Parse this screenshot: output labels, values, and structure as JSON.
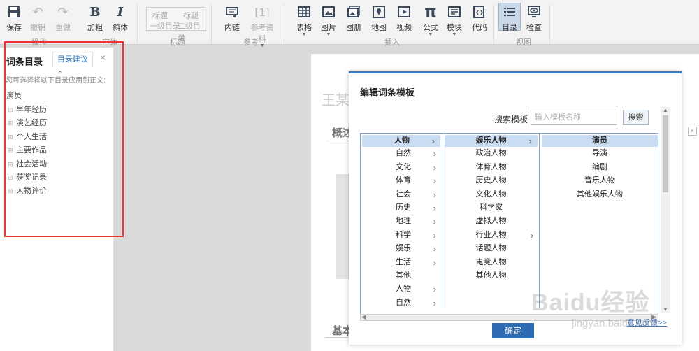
{
  "toolbar": {
    "save": "保存",
    "undo": "撤销",
    "redo": "重做",
    "bold": "加粗",
    "italic": "斜体",
    "heading1_title": "标题",
    "heading1_sub": "一级目录",
    "heading2_title": "标题",
    "heading2_sub": "二级目录",
    "link": "内链",
    "ref_number": "[1]",
    "reference": "参考资料",
    "table": "表格",
    "image": "图片",
    "album": "图册",
    "map": "地图",
    "video": "视频",
    "formula": "公式",
    "module": "模块",
    "code": "代码",
    "toc": "目录",
    "check": "检查",
    "groups": {
      "operate": "操作",
      "font": "字体",
      "heading": "标题",
      "reference": "参考",
      "insert": "插入",
      "view": "视图"
    }
  },
  "left_panel": {
    "title": "词条目录",
    "tab_label": "目录建议",
    "close": "×",
    "hint": "您可选择将以下目录应用到正文:",
    "root": "演员",
    "items": [
      "早年经历",
      "演艺经历",
      "个人生活",
      "主要作品",
      "社会活动",
      "获奖记录",
      "人物评价"
    ],
    "toggle": "⊞"
  },
  "document": {
    "title": "王某",
    "section1": "概述",
    "section2": "基本"
  },
  "modal": {
    "title": "编辑词条模板",
    "search_label": "搜索模板",
    "search_placeholder": "输入模板名称",
    "search_button": "搜索",
    "col1": [
      "人物",
      "自然",
      "文化",
      "体育",
      "社会",
      "历史",
      "地理",
      "科学",
      "娱乐",
      "生活",
      "其他",
      "人物",
      "自然"
    ],
    "col2": [
      "娱乐人物",
      "政治人物",
      "体育人物",
      "历史人物",
      "文化人物",
      "科学家",
      "虚拟人物",
      "行业人物",
      "话题人物",
      "电竞人物",
      "其他人物"
    ],
    "col3": [
      "演员",
      "导演",
      "编剧",
      "音乐人物",
      "其他娱乐人物"
    ],
    "ok_button": "确定",
    "feedback": "意见反馈>>"
  },
  "watermark": {
    "text": "Baidu经验",
    "url": "jingyan.baidu.com"
  }
}
